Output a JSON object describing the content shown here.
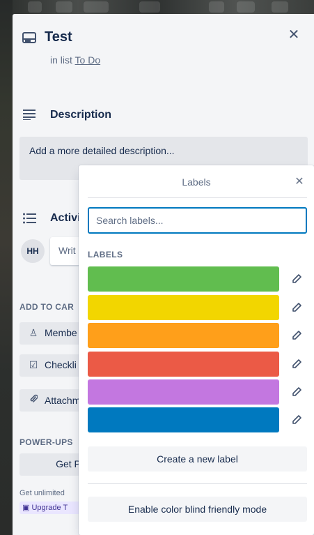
{
  "card": {
    "title": "Test",
    "list_prefix": "in list",
    "list_name": "To Do",
    "close_glyph": "✕"
  },
  "description": {
    "title": "Description",
    "placeholder": "Add a more detailed description..."
  },
  "activity": {
    "title": "Activi",
    "avatar_initials": "HH",
    "comment_placeholder": "Writ"
  },
  "add_to_card": {
    "heading": "ADD TO CAR",
    "buttons": [
      {
        "label": "Membe",
        "icon": "person-icon",
        "glyph": "♙"
      },
      {
        "label": "Checkli",
        "icon": "checkbox-icon",
        "glyph": "☑"
      },
      {
        "label": "Attachm",
        "icon": "paperclip-icon",
        "glyph": "⌀"
      }
    ]
  },
  "power_ups": {
    "heading": "POWER-UPS",
    "get_button": "Get P",
    "small_text": "Get unlimited",
    "upgrade_label": "Upgrade T"
  },
  "labels_popover": {
    "title": "Labels",
    "close_glyph": "✕",
    "search_placeholder": "Search labels...",
    "labels_heading": "LABELS",
    "labels": [
      {
        "color": "#61bd4f",
        "name": "green"
      },
      {
        "color": "#f2d600",
        "name": "yellow"
      },
      {
        "color": "#ff9f1a",
        "name": "orange"
      },
      {
        "color": "#eb5a46",
        "name": "red"
      },
      {
        "color": "#c377e0",
        "name": "purple"
      },
      {
        "color": "#0079bf",
        "name": "blue"
      }
    ],
    "create_label": "Create a new label",
    "colorblind_label": "Enable color blind friendly mode"
  }
}
